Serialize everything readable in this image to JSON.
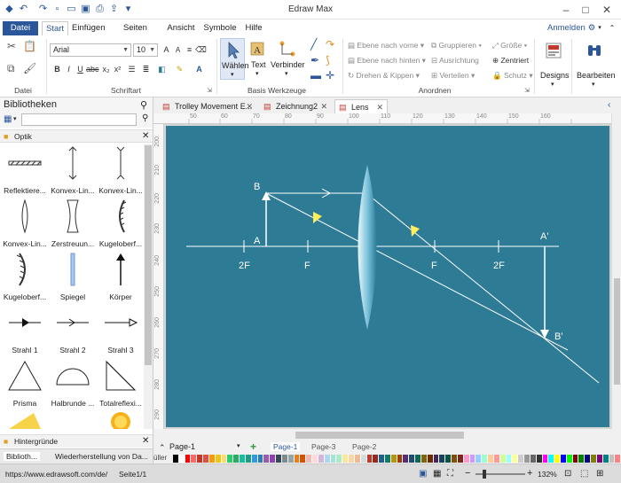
{
  "app": {
    "title": "Edraw Max"
  },
  "ribbon_tabs": [
    "Datei",
    "Start",
    "Einfügen",
    "Seiten Layout",
    "Ansicht",
    "Symbole",
    "Hilfe"
  ],
  "account": {
    "login": "Anmelden"
  },
  "ribbon": {
    "groups": {
      "datei": "Datei",
      "schriftart": "Schriftart",
      "basis": "Basis Werkzeuge",
      "anordnen": "Anordnen"
    },
    "font": {
      "name": "Arial",
      "size": "10"
    },
    "tools": {
      "select": "Wählen",
      "text": "Text",
      "connector": "Verbinder"
    },
    "arrange": {
      "forward": "Ebene nach vorne",
      "backward": "Ebene nach hinten",
      "rotate": "Drehen & Kippen",
      "group": "Gruppieren",
      "align": "Ausrichtung",
      "distribute": "Verteilen",
      "size": "Größe",
      "center": "Zentriert",
      "protect": "Schutz"
    },
    "designs": "Designs",
    "edit": "Bearbeiten"
  },
  "library": {
    "title": "Bibliotheken",
    "category": "Optik",
    "shapes": [
      "Reflektiere...",
      "Konvex-Lin...",
      "Konvex-Lin...",
      "Konvex-Lin...",
      "Zerstreuun...",
      "Kugeloberf...",
      "Kugeloberf...",
      "Spiegel",
      "Körper",
      "Strahl 1",
      "Strahl 2",
      "Strahl 3",
      "Prisma",
      "Halbrunde ...",
      "Totalreflexi..."
    ],
    "section2": "Hintergründe",
    "bottom_tabs": [
      "Biblioth...",
      "Wiederherstellung von Da..."
    ]
  },
  "doc_tabs": [
    "Trolley Movement E...",
    "Zeichnung2",
    "Lens"
  ],
  "ruler": {
    "h": [
      "50",
      "60",
      "70",
      "80",
      "90",
      "100",
      "110",
      "120",
      "130",
      "140",
      "150",
      "160"
    ],
    "v": [
      "200",
      "210",
      "220",
      "230",
      "240",
      "250",
      "260",
      "270",
      "280",
      "290"
    ]
  },
  "diagram": {
    "bg": "#2e7b96",
    "labels": {
      "B": "B",
      "A": "A",
      "Aprime": "A'",
      "Bprime": "B'",
      "twoF_left": "2F",
      "F_left": "F",
      "F_right": "F",
      "twoF_right": "2F"
    }
  },
  "pages": {
    "current": "Page-1",
    "tabs": [
      "Page-1",
      "Page-3",
      "Page-2"
    ]
  },
  "status": {
    "url": "https://www.edrawsoft.com/de/",
    "page": "Seite1/1",
    "zoom": "132%",
    "fill_label": "üller"
  },
  "palette": [
    "#000000",
    "#ffffff",
    "#ff0000",
    "#ff6666",
    "#c0392b",
    "#e74c3c",
    "#f39c12",
    "#f1c40f",
    "#f7dc6f",
    "#2ecc71",
    "#27ae60",
    "#1abc9c",
    "#16a085",
    "#3498db",
    "#2980b9",
    "#9b59b6",
    "#8e44ad",
    "#34495e",
    "#7f8c8d",
    "#95a5a6",
    "#e67e22",
    "#d35400",
    "#f5b7b1",
    "#fadbd8",
    "#d2b4de",
    "#aed6f1",
    "#a3e4d7",
    "#abebc6",
    "#f9e79f",
    "#fad7a0",
    "#edbb99",
    "#d5dbdb",
    "#c0392b",
    "#922b21",
    "#1f618d",
    "#117a65",
    "#b7950b",
    "#a04000",
    "#5b2c6f",
    "#1b4f72",
    "#0e6655",
    "#7d6608",
    "#6e2c00",
    "#4a235a",
    "#154360",
    "#0b5345",
    "#7e5109",
    "#78281f",
    "#ff99cc",
    "#cc99ff",
    "#99ccff",
    "#99ffcc",
    "#ffcc99",
    "#ff9999",
    "#ccff99",
    "#99ffff",
    "#ffff99",
    "#cccccc",
    "#999999",
    "#666666",
    "#333333",
    "#ff00ff",
    "#00ffff",
    "#ffff00",
    "#0000ff",
    "#00ff00",
    "#800000",
    "#008000",
    "#000080",
    "#808000",
    "#800080",
    "#008080",
    "#c0c0c0",
    "#ff8080"
  ]
}
